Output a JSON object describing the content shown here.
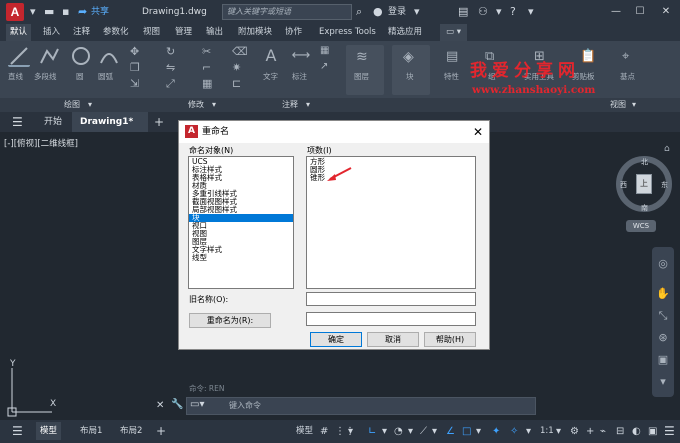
{
  "titlebar": {
    "logo": "A",
    "share": "共享",
    "doc_title": "Drawing1.dwg",
    "search_placeholder": "键入关键字或短语",
    "login": "登录"
  },
  "ribbon_tabs": [
    "默认",
    "插入",
    "注释",
    "参数化",
    "视图",
    "管理",
    "输出",
    "附加模块",
    "协作",
    "Express Tools",
    "精选应用"
  ],
  "ribbon_buttons": {
    "line": "直线",
    "polyline": "多段线",
    "circle": "圆",
    "arc": "圆弧",
    "text": "文字",
    "dimension": "标注",
    "layers": "图层",
    "block": "块",
    "properties": "特性",
    "groups": "组",
    "utilities": "实用工具",
    "clipboard": "剪贴板",
    "base": "基点"
  },
  "ribbon_groups": [
    "绘图",
    "修改",
    "注释",
    "视图"
  ],
  "doc_tabs": {
    "start": "开始",
    "drawing": "Drawing1*"
  },
  "viewport_label": "[-][俯视][二维线框]",
  "viewcube": {
    "north": "北",
    "south": "南",
    "west": "西",
    "east": "东",
    "center": "上",
    "wcs": "WCS"
  },
  "dialog": {
    "title": "重命名",
    "named_objects_label": "命名对象(N)",
    "items_label": "项数(I)",
    "named_objects": [
      "UCS",
      "标注样式",
      "表格样式",
      "材质",
      "多重引线样式",
      "截面视图样式",
      "局部视图样式",
      "块",
      "视口",
      "视图",
      "图层",
      "文字样式",
      "线型"
    ],
    "selected_index": 7,
    "items": [
      "方形",
      "圆形",
      "锥形"
    ],
    "old_name_label": "旧名称(O):",
    "rename_to_button": "重命名为(R):",
    "ok": "确定",
    "cancel": "取消",
    "help": "帮助(H)"
  },
  "command": {
    "history": "命令: REN",
    "placeholder": "键入命令"
  },
  "statusbar": {
    "tabs": [
      "模型",
      "布局1",
      "布局2"
    ],
    "model_button": "模型",
    "scale": "1:1"
  },
  "watermark": {
    "line1": "我爱分享网",
    "line2": "www.zhanshaoyi.com"
  },
  "colors": {
    "accent": "#0078d7",
    "brand": "#c4262e",
    "watermark": "#e2262e",
    "arrow": "#e2262e"
  }
}
